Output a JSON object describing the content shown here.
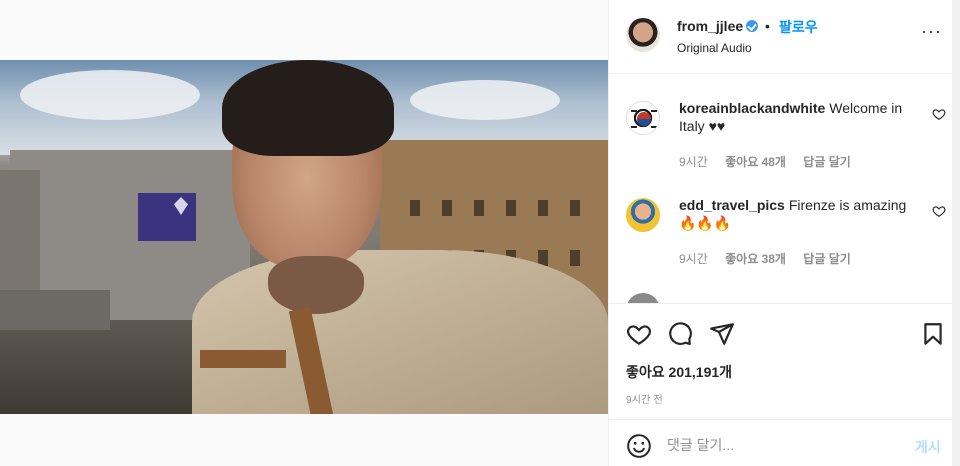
{
  "post": {
    "username": "from_jjlee",
    "follow_label": "팔로우",
    "separator": "•",
    "audio_label": "Original Audio",
    "more_label": "···"
  },
  "comments": [
    {
      "username": "koreainblackandwhite",
      "text": "Welcome in Italy ♥♥",
      "time": "9시간",
      "likes": "좋아요 48개",
      "reply": "답글 달기"
    },
    {
      "username": "edd_travel_pics",
      "text": "Firenze is amazing 🔥🔥🔥",
      "time": "9시간",
      "likes": "좋아요 38개",
      "reply": "답글 달기"
    }
  ],
  "engagement": {
    "likes_label": "좋아요 201,191개",
    "posted_time": "9시간 전"
  },
  "add_comment": {
    "placeholder": "댓글 달기...",
    "post_label": "게시"
  },
  "colors": {
    "link_blue": "#0095f6",
    "verified_blue": "#3897f0",
    "muted_text": "#8e8e8e",
    "post_disabled": "#b2dffc"
  },
  "icons": {
    "sound": "speaker-icon",
    "like": "heart-icon",
    "comment": "comment-icon",
    "share": "send-icon",
    "save": "bookmark-icon",
    "emoji": "smiley-icon",
    "more": "more-icon"
  }
}
